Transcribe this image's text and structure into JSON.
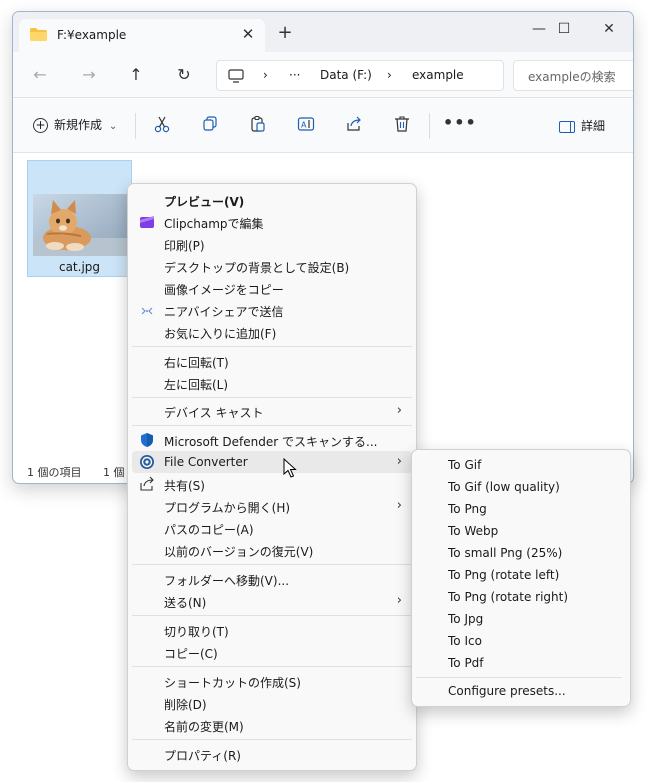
{
  "window": {
    "tab_title": "F:¥example",
    "tab_close": "✕",
    "tab_add": "+",
    "controls": {
      "minimize": "—",
      "maximize": "☐",
      "close": "✕"
    }
  },
  "nav": {
    "back": "←",
    "forward": "→",
    "up": "↑",
    "refresh": "↻"
  },
  "address": {
    "computer_icon": "monitor-icon",
    "separator": "›",
    "ellipsis": "···",
    "parts": [
      "Data (F:)",
      "example"
    ],
    "search_placeholder": "exampleの検索"
  },
  "toolbar": {
    "new_label": "新規作成",
    "new_chevron": "⌄",
    "detail_label": "詳細",
    "more": "•••",
    "icons": [
      "cut-icon",
      "copy-icon",
      "paste-icon",
      "rename-icon",
      "share-icon",
      "delete-icon"
    ]
  },
  "file": {
    "name": "cat.jpg"
  },
  "status": {
    "items_count": "1 個の項目",
    "selected_count": "1 個"
  },
  "context_menu": {
    "items": [
      {
        "label": "プレビュー(V)",
        "bold": true
      },
      {
        "label": "Clipchampで編集",
        "icon": "clipchamp-icon"
      },
      {
        "label": "印刷(P)"
      },
      {
        "label": "デスクトップの背景として設定(B)"
      },
      {
        "label": "画像イメージをコピー"
      },
      {
        "label": "ニアバイシェアで送信",
        "icon": "nearby-share-icon"
      },
      {
        "label": "お気に入りに追加(F)"
      },
      {
        "label": "右に回転(T)"
      },
      {
        "label": "左に回転(L)"
      },
      {
        "label": "デバイス キャスト",
        "submenu": true
      },
      {
        "label": "Microsoft Defender でスキャンする...",
        "icon": "defender-shield-icon"
      },
      {
        "label": "File Converter",
        "icon": "file-converter-icon",
        "submenu": true,
        "hover": true
      },
      {
        "label": "共有(S)",
        "icon": "share-icon"
      },
      {
        "label": "プログラムから開く(H)",
        "submenu": true
      },
      {
        "label": "パスのコピー(A)"
      },
      {
        "label": "以前のバージョンの復元(V)"
      },
      {
        "label": "フォルダーへ移動(V)..."
      },
      {
        "label": "送る(N)",
        "submenu": true
      },
      {
        "label": "切り取り(T)"
      },
      {
        "label": "コピー(C)"
      },
      {
        "label": "ショートカットの作成(S)"
      },
      {
        "label": "削除(D)"
      },
      {
        "label": "名前の変更(M)"
      },
      {
        "label": "プロパティ(R)"
      }
    ],
    "arrow": "›"
  },
  "file_converter_menu": {
    "items": [
      "To Gif",
      "To Gif (low quality)",
      "To Png",
      "To Webp",
      "To small Png (25%)",
      "To Png (rotate left)",
      "To Png (rotate right)",
      "To Jpg",
      "To Ico",
      "To Pdf"
    ],
    "configure": "Configure presets..."
  },
  "colors": {
    "accent": "#1c5fb5",
    "selection": "#cce4f7",
    "menu_bg": "#f9f9f9",
    "folder": "#f5c242"
  }
}
